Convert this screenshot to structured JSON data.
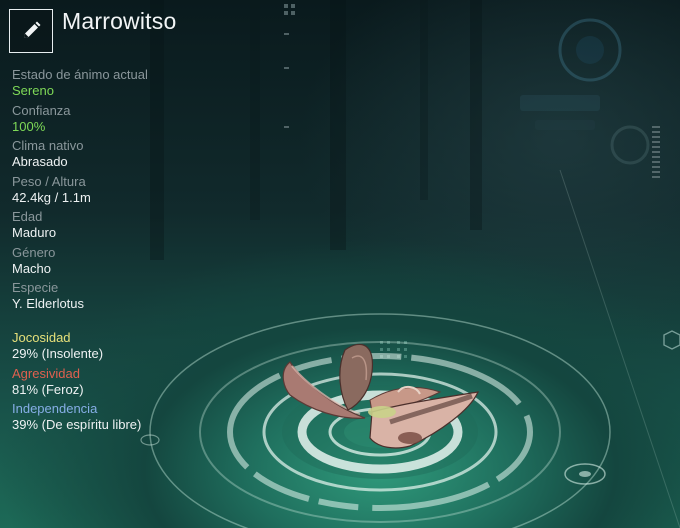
{
  "header": {
    "name": "Marrowitso",
    "edit_icon": "pencil-icon"
  },
  "stats": [
    {
      "label": "Estado de ánimo actual",
      "value": "Sereno",
      "highlight": true
    },
    {
      "label": "Confianza",
      "value": "100%",
      "highlight": true
    },
    {
      "label": "Clima nativo",
      "value": "Abrasado",
      "highlight": false
    },
    {
      "label": "Peso / Altura",
      "value": "42.4kg / 1.1m",
      "highlight": false
    },
    {
      "label": "Edad",
      "value": "Maduro",
      "highlight": false
    },
    {
      "label": "Género",
      "value": "Macho",
      "highlight": false
    },
    {
      "label": "Especie",
      "value": "Y. Elderlotus",
      "highlight": false
    }
  ],
  "traits": [
    {
      "label": "Jocosidad",
      "value": "29% (Insolente)",
      "color": "#e6e07a"
    },
    {
      "label": "Agresividad",
      "value": "81% (Feroz)",
      "color": "#e0604f"
    },
    {
      "label": "Independencia",
      "value": "39% (De espíritu libre)",
      "color": "#86aee6"
    }
  ],
  "colors": {
    "accent_green": "#7ed957",
    "label_gray": "#8a979b"
  }
}
